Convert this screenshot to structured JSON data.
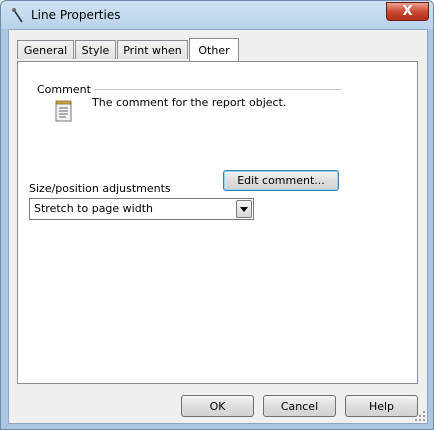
{
  "window": {
    "title": "Line Properties",
    "close_glyph": "X"
  },
  "tabs": [
    {
      "label": "General"
    },
    {
      "label": "Style"
    },
    {
      "label": "Print when"
    },
    {
      "label": "Other"
    }
  ],
  "active_tab": "Other",
  "comment": {
    "label": "Comment",
    "text": "The comment for the report object.",
    "edit_button": "Edit comment...",
    "icon": "notepad-icon"
  },
  "size_position": {
    "label": "Size/position adjustments",
    "selected": "Stretch to page width"
  },
  "buttons": {
    "ok": "OK",
    "cancel": "Cancel",
    "help": "Help"
  }
}
